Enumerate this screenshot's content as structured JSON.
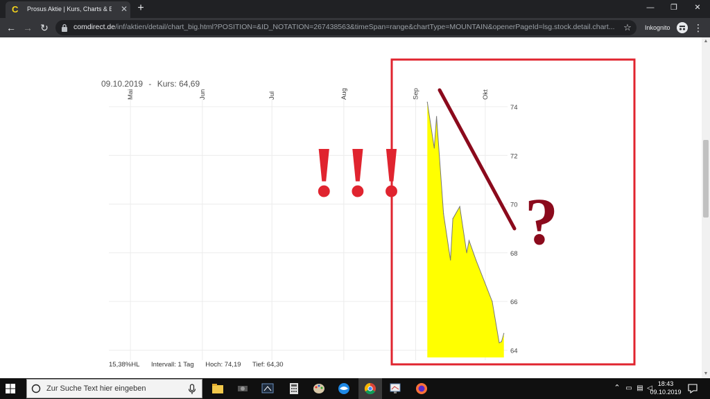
{
  "browser": {
    "tab_title": "Prosus Aktie | Kurs, Charts & Entv",
    "tab_favicon": "C",
    "url_host": "comdirect.de",
    "url_path": "/inf/aktien/detail/chart_big.html?POSITION=&ID_NOTATION=267438563&timeSpan=range&chartType=MOUNTAIN&openerPageId=lsg.stock.detail.chart...",
    "incognito_label": "Inkognito"
  },
  "chart_header": {
    "date": "09.10.2019",
    "separator": "-",
    "kurs_label": "Kurs: 64,69"
  },
  "chart_data": {
    "type": "area",
    "x_tick_labels": [
      "Mai",
      "Jun",
      "Jul",
      "Aug",
      "Sep",
      "Okt"
    ],
    "y_tick_labels": [
      "74",
      "72",
      "70",
      "68",
      "66",
      "64"
    ],
    "y_ticks": [
      74,
      72,
      70,
      68,
      66,
      64
    ],
    "ylim": [
      63.7,
      74.4
    ],
    "series": [
      {
        "x": [
          "2019-09-06",
          "2019-09-09",
          "2019-09-10",
          "2019-09-13",
          "2019-09-16",
          "2019-09-17",
          "2019-09-20",
          "2019-09-23",
          "2019-09-24",
          "2019-09-27",
          "2019-10-04",
          "2019-10-07",
          "2019-10-08",
          "2019-10-09"
        ],
        "y": [
          74.19,
          72.3,
          73.6,
          69.6,
          67.7,
          69.4,
          69.9,
          68.0,
          68.5,
          67.7,
          66.0,
          64.3,
          64.35,
          64.69
        ]
      }
    ],
    "fill_color": "#ffff00",
    "line_color": "#777777",
    "grid": true
  },
  "annotations": {
    "exclamations": "!!!",
    "question": "?",
    "box_color": "#e0242f",
    "exclaim_color": "#e0242f",
    "slash_color": "#8b0a1c"
  },
  "footer": {
    "hl": "15,38%HL",
    "interval": "Intervall: 1 Tag",
    "hoch": "Hoch:  74,19",
    "tief": "Tief:  64,30"
  },
  "taskbar": {
    "search_placeholder": "Zur Suche Text hier eingeben",
    "time": "18:43",
    "date": "09.10.2019"
  }
}
